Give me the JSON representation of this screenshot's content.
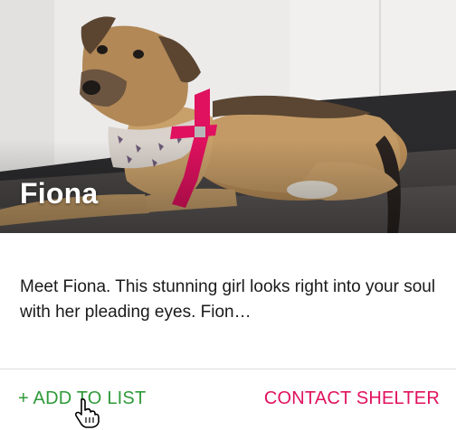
{
  "pet": {
    "name": "Fiona",
    "description": "Meet Fiona. This stunning girl looks right into your soul with her pleading eyes. Fion…"
  },
  "actions": {
    "add_to_list": "+ ADD TO LIST",
    "contact_shelter": "CONTACT SHELTER"
  },
  "colors": {
    "add_to_list": "#2f9a39",
    "contact_shelter": "#e0115f",
    "harness": "#e0115f"
  },
  "icons": {
    "cursor": "hand-pointer-icon"
  }
}
